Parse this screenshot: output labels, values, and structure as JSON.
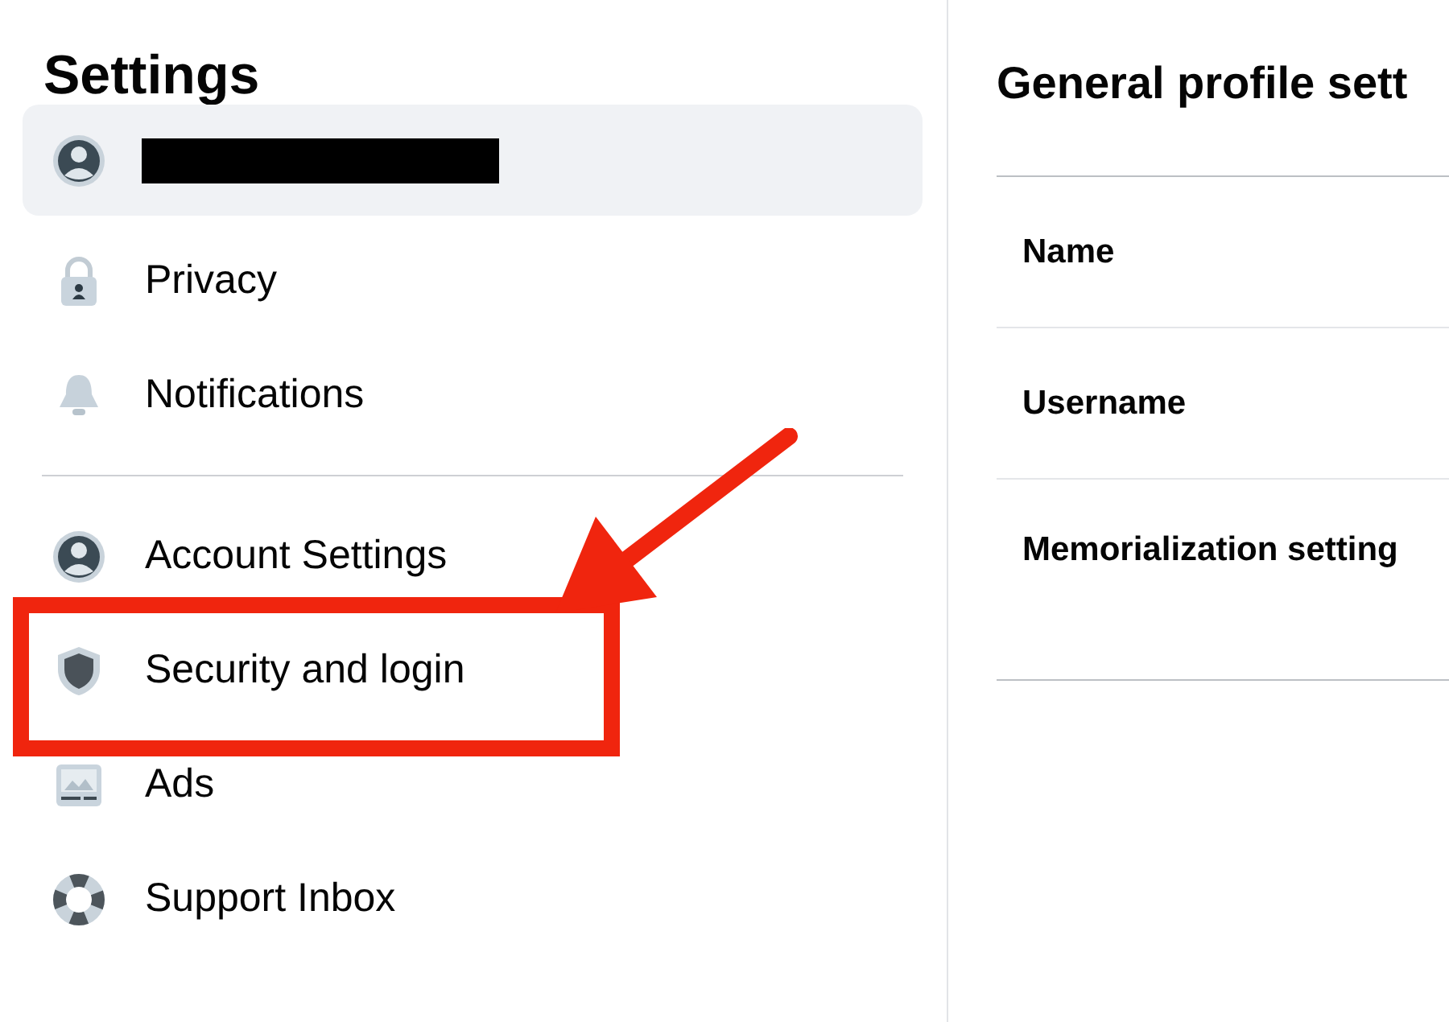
{
  "sidebar": {
    "title": "Settings",
    "groups": [
      {
        "items": [
          {
            "kind": "profile",
            "redacted": true,
            "selected": true,
            "highlighted": false
          },
          {
            "kind": "privacy",
            "label": "Privacy",
            "redacted": false,
            "selected": false,
            "highlighted": false
          },
          {
            "kind": "notifications",
            "label": "Notifications",
            "redacted": false,
            "selected": false,
            "highlighted": false
          }
        ]
      },
      {
        "items": [
          {
            "kind": "account",
            "label": "Account Settings",
            "redacted": false,
            "selected": false,
            "highlighted": false
          },
          {
            "kind": "security",
            "label": "Security and login",
            "redacted": false,
            "selected": false,
            "highlighted": true
          },
          {
            "kind": "ads",
            "label": "Ads",
            "redacted": false,
            "selected": false,
            "highlighted": false
          },
          {
            "kind": "support",
            "label": "Support Inbox",
            "redacted": false,
            "selected": false,
            "highlighted": false
          }
        ]
      }
    ]
  },
  "panel": {
    "title": "General profile sett",
    "rows": [
      {
        "label": "Name"
      },
      {
        "label": "Username"
      },
      {
        "label": "Memorialization setting"
      }
    ]
  }
}
